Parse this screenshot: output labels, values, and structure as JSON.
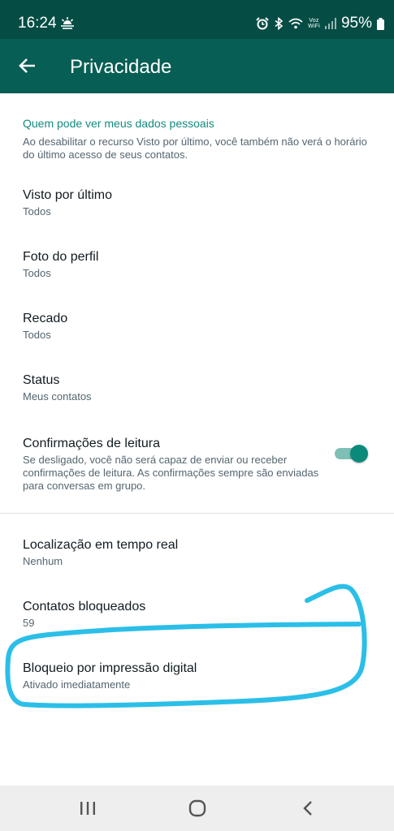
{
  "status_bar": {
    "time": "16:24",
    "weather_icon": "sun-haze-icon",
    "voz_label": "Voz",
    "wifi_label": "WiFi",
    "battery": "95%"
  },
  "app_bar": {
    "title": "Privacidade",
    "back_icon": "arrow-left-icon"
  },
  "section": {
    "header": "Quem pode ver meus dados pessoais",
    "description": "Ao desabilitar o recurso Visto por último, você também não verá o horário do último acesso de seus contatos."
  },
  "settings": [
    {
      "title": "Visto por último",
      "value": "Todos"
    },
    {
      "title": "Foto do perfil",
      "value": "Todos"
    },
    {
      "title": "Recado",
      "value": "Todos"
    },
    {
      "title": "Status",
      "value": "Meus contatos"
    }
  ],
  "read_receipts": {
    "title": "Confirmações de leitura",
    "description": "Se desligado, você não será capaz de enviar ou receber confirmações de leitura. As confirmações sempre são enviadas para conversas em grupo.",
    "enabled": true
  },
  "more_settings": [
    {
      "title": "Localização em tempo real",
      "value": "Nenhum"
    },
    {
      "title": "Contatos bloqueados",
      "value": "59"
    },
    {
      "title": "Bloqueio por impressão digital",
      "value": "Ativado imediatamente"
    }
  ],
  "colors": {
    "status_bar": "#054d44",
    "app_bar": "#075e54",
    "accent": "#128c7e",
    "annotation": "#2bbfe8"
  }
}
